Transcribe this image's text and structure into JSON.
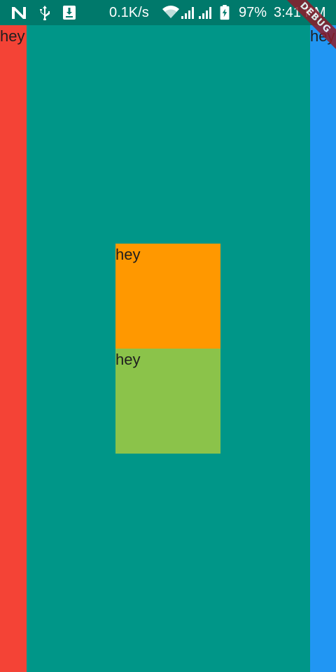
{
  "status_bar": {
    "network_speed": "0.1K/s",
    "battery_percent": "97%",
    "time": "3:41 PM",
    "background_color": "#00796b",
    "icons": [
      "n-notification-icon",
      "usb-icon",
      "download-icon",
      "wifi-icon",
      "signal-icon",
      "signal-icon-2",
      "battery-charging-icon"
    ]
  },
  "layout": {
    "left_panel": {
      "label": "hey",
      "color": "#f44336"
    },
    "center_panel": {
      "color": "#009688"
    },
    "right_panel": {
      "label": "hey",
      "color": "#2196f3"
    },
    "center_boxes": [
      {
        "label": "hey",
        "color": "#ff9800"
      },
      {
        "label": "hey",
        "color": "#8bc34a"
      }
    ]
  },
  "debug_banner": {
    "label": "DEBUG",
    "color": "#8c1d2b"
  }
}
